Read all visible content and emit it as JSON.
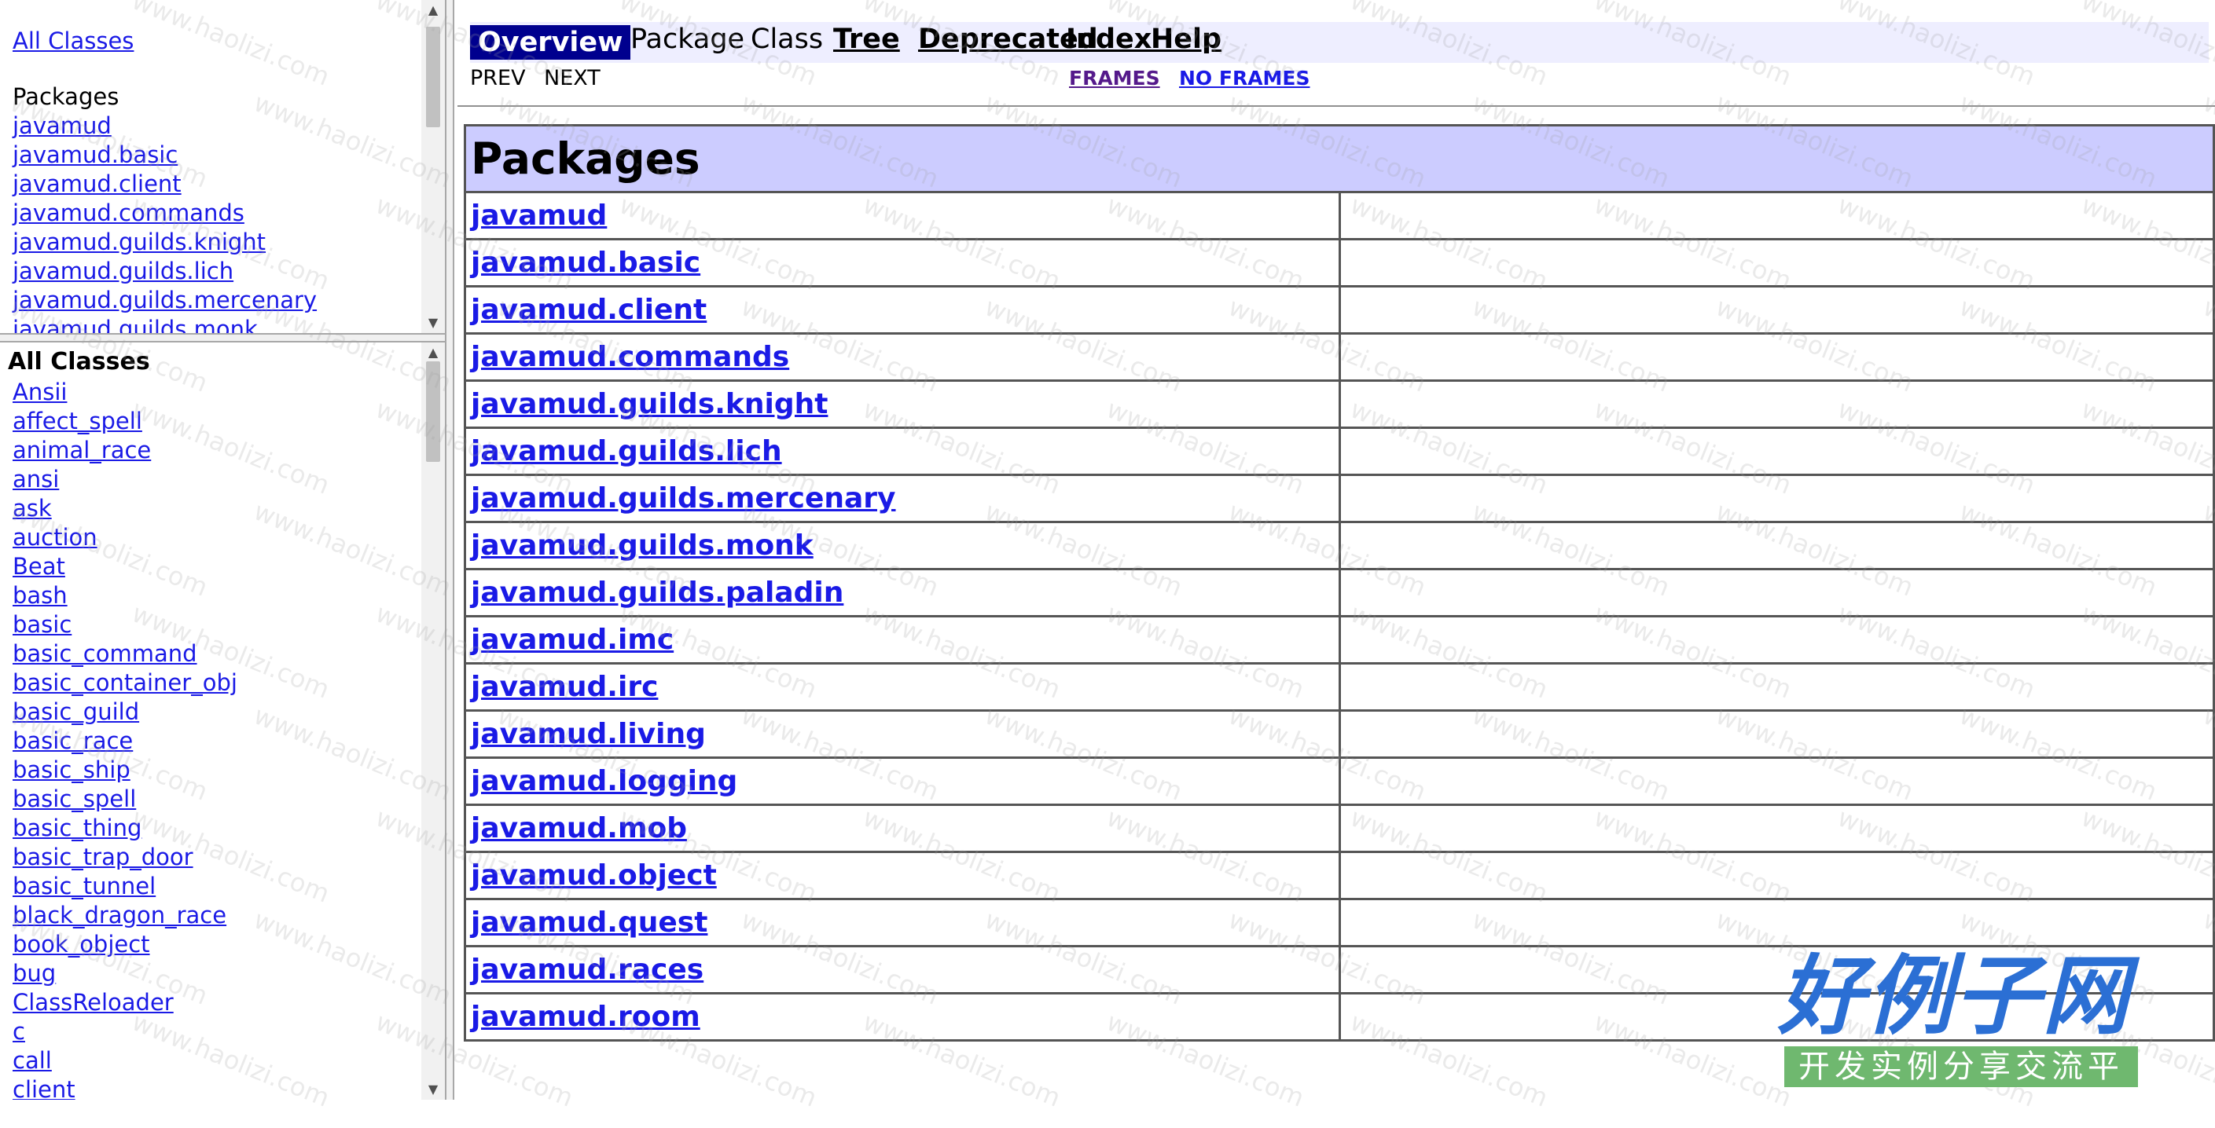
{
  "package_frame": {
    "all_classes_link": "All Classes",
    "heading": "Packages",
    "packages": [
      "javamud",
      "javamud.basic",
      "javamud.client",
      "javamud.commands",
      "javamud.guilds.knight",
      "javamud.guilds.lich",
      "javamud.guilds.mercenary",
      "javamud.guilds.monk"
    ]
  },
  "class_frame": {
    "heading": "All Classes",
    "classes": [
      "Ansii",
      "affect_spell",
      "animal_race",
      "ansi",
      "ask",
      "auction",
      "Beat",
      "bash",
      "basic",
      "basic_command",
      "basic_container_obj",
      "basic_guild",
      "basic_race",
      "basic_ship",
      "basic_spell",
      "basic_thing",
      "basic_trap_door",
      "basic_tunnel",
      "black_dragon_race",
      "book_object",
      "bug",
      "ClassReloader",
      "c",
      "call",
      "client"
    ]
  },
  "main_frame": {
    "nav": {
      "overview": "Overview",
      "package": "Package",
      "class": "Class",
      "tree": "Tree",
      "deprecated": "Deprecated",
      "index": "Index",
      "help": "Help"
    },
    "subnav": {
      "prev": "PREV",
      "next": "NEXT",
      "frames": "FRAMES",
      "no_frames": "NO FRAMES"
    },
    "table": {
      "heading": "Packages",
      "rows": [
        "javamud",
        "javamud.basic",
        "javamud.client",
        "javamud.commands",
        "javamud.guilds.knight",
        "javamud.guilds.lich",
        "javamud.guilds.mercenary",
        "javamud.guilds.monk",
        "javamud.guilds.paladin",
        "javamud.imc",
        "javamud.irc",
        "javamud.living",
        "javamud.logging",
        "javamud.mob",
        "javamud.object",
        "javamud.quest",
        "javamud.races",
        "javamud.room"
      ]
    }
  },
  "watermark": {
    "text": "www.haolizi.com",
    "logo_title": "好例子网",
    "logo_subtitle": "开发实例分享交流平台"
  },
  "colors": {
    "link": "#1a1ae6",
    "visited_link": "#551a8b",
    "nav_background": "#eeeeff",
    "nav_active": "#00008e",
    "table_header": "#ccccff"
  }
}
